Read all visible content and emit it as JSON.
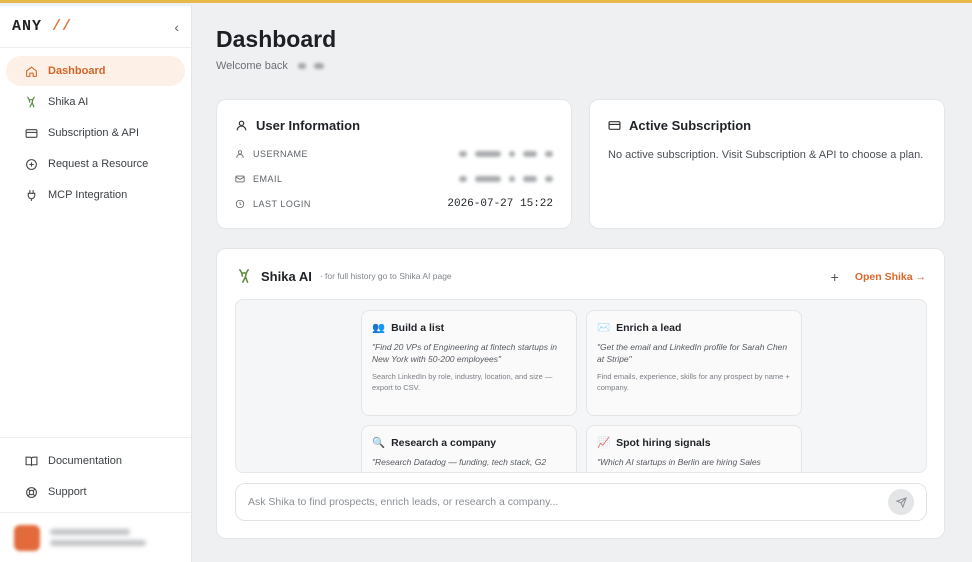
{
  "sidebar": {
    "logo": {
      "text": "ANY",
      "slashes": "//"
    },
    "collapse_icon": "‹",
    "items": [
      {
        "label": "Dashboard",
        "icon": "home-icon"
      },
      {
        "label": "Shika AI",
        "icon": "deer-icon"
      },
      {
        "label": "Subscription & API",
        "icon": "card-icon"
      },
      {
        "label": "Request a Resource",
        "icon": "plus-circle-icon"
      },
      {
        "label": "MCP Integration",
        "icon": "plug-icon"
      }
    ],
    "bottom_items": [
      {
        "label": "Documentation",
        "icon": "book-icon"
      },
      {
        "label": "Support",
        "icon": "lifebuoy-icon"
      }
    ]
  },
  "header": {
    "title": "Dashboard",
    "welcome": "Welcome back"
  },
  "user_info": {
    "title": "User Information",
    "username_label": "USERNAME",
    "email_label": "EMAIL",
    "last_login_label": "LAST LOGIN",
    "last_login_value": "2026-07-27 15:22"
  },
  "subscription": {
    "title": "Active Subscription",
    "message": "No active subscription. Visit Subscription & API to choose a plan."
  },
  "shika": {
    "title": "Shika AI",
    "hint": "· for full history go to Shika AI page",
    "plus": "+",
    "open_label": "Open Shika →",
    "suggestions": [
      {
        "emoji": "👥",
        "title": "Build a list",
        "quote": "\"Find 20 VPs of Engineering at fintech startups in New York with 50-200 employees\"",
        "desc": "Search LinkedIn by role, industry, location, and size — export to CSV."
      },
      {
        "emoji": "✉️",
        "title": "Enrich a lead",
        "quote": "\"Get the email and LinkedIn profile for Sarah Chen at Stripe\"",
        "desc": "Find emails, experience, skills for any prospect by name + company."
      },
      {
        "emoji": "🔍",
        "title": "Research a company",
        "quote": "\"Research Datadog — funding, tech stack, G2",
        "desc": ""
      },
      {
        "emoji": "📈",
        "title": "Spot hiring signals",
        "quote": "\"Which AI startups in Berlin are hiring Sales",
        "desc": ""
      }
    ],
    "input_placeholder": "Ask Shika to find prospects, enrich leads, or research a company..."
  },
  "colors": {
    "accent": "#d9682a",
    "active_bg": "#fdf0e6",
    "top_bar": "#e8b84a"
  }
}
